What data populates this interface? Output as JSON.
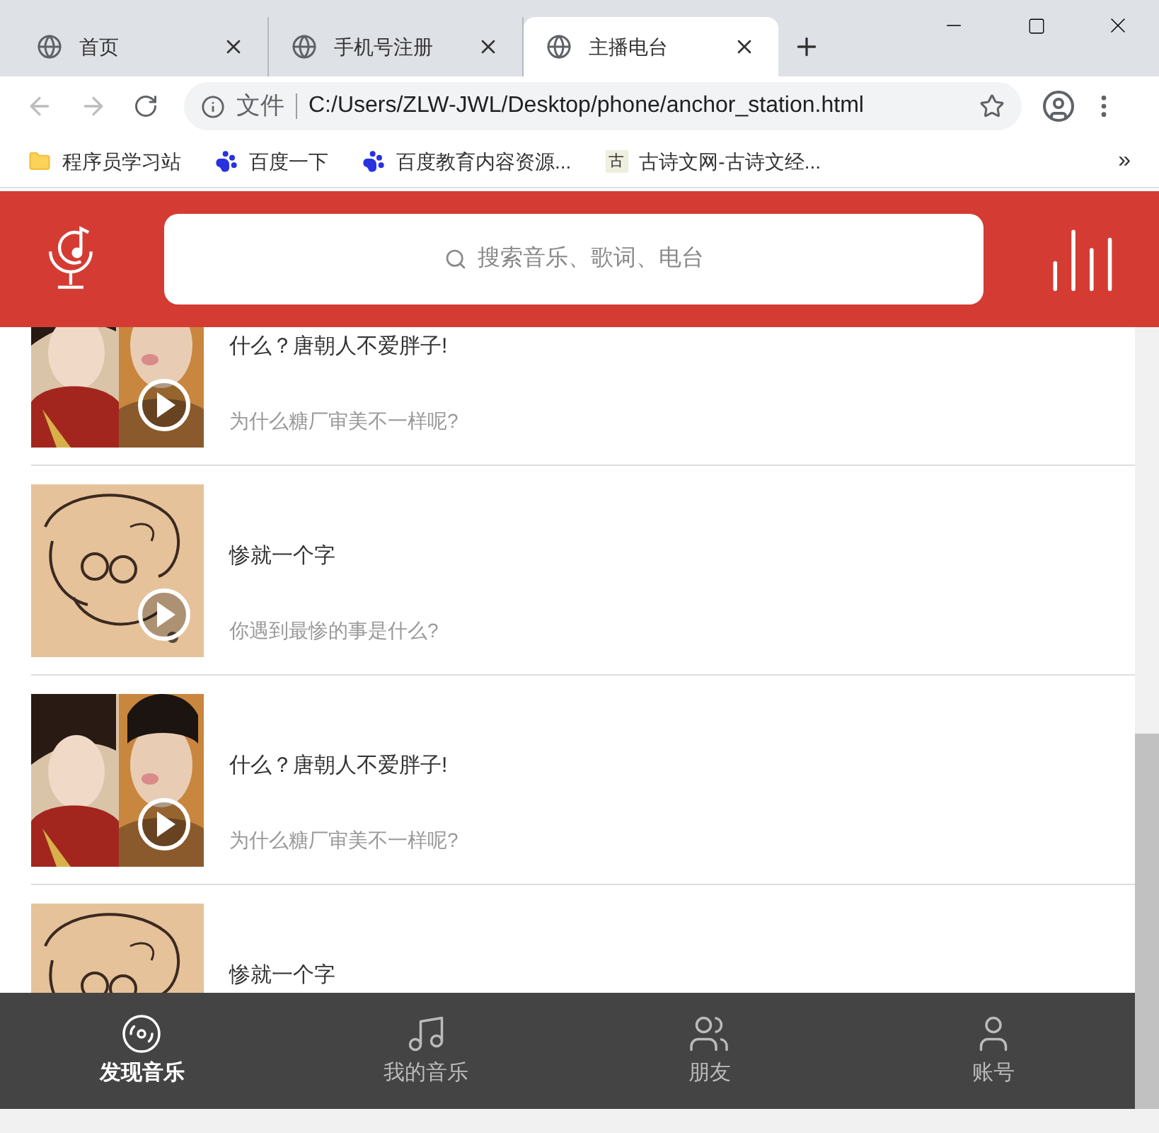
{
  "browser": {
    "tabs": [
      {
        "label": "首页",
        "selected": false
      },
      {
        "label": "手机号注册",
        "selected": false
      },
      {
        "label": "主播电台",
        "selected": true
      }
    ],
    "address": {
      "scheme_label": "文件",
      "url": "C:/Users/ZLW-JWL/Desktop/phone/anchor_station.html"
    },
    "bookmarks": [
      {
        "label": "程序员学习站",
        "kind": "folder"
      },
      {
        "label": "百度一下",
        "kind": "paw"
      },
      {
        "label": "百度教育内容资源...",
        "kind": "paw"
      },
      {
        "label": "古诗文网-古诗文经...",
        "kind": "glyph",
        "glyph": "古"
      }
    ],
    "more_bookmarks": "»"
  },
  "header": {
    "search_placeholder": "搜索音乐、歌词、电台"
  },
  "stations": [
    {
      "title": "什么？唐朝人不爱胖子!",
      "subtitle": "为什么糖厂审美不一样呢?"
    },
    {
      "title": "惨就一个字",
      "subtitle": "你遇到最惨的事是什么?"
    },
    {
      "title": "什么？唐朝人不爱胖子!",
      "subtitle": "为什么糖厂审美不一样呢?"
    },
    {
      "title": "惨就一个字"
    }
  ],
  "nav": [
    {
      "label": "发现音乐",
      "selected": true,
      "kind": "disc"
    },
    {
      "label": "我的音乐",
      "selected": false,
      "kind": "note"
    },
    {
      "label": "朋友",
      "selected": false,
      "kind": "friends"
    },
    {
      "label": "账号",
      "selected": false,
      "kind": "person"
    }
  ]
}
